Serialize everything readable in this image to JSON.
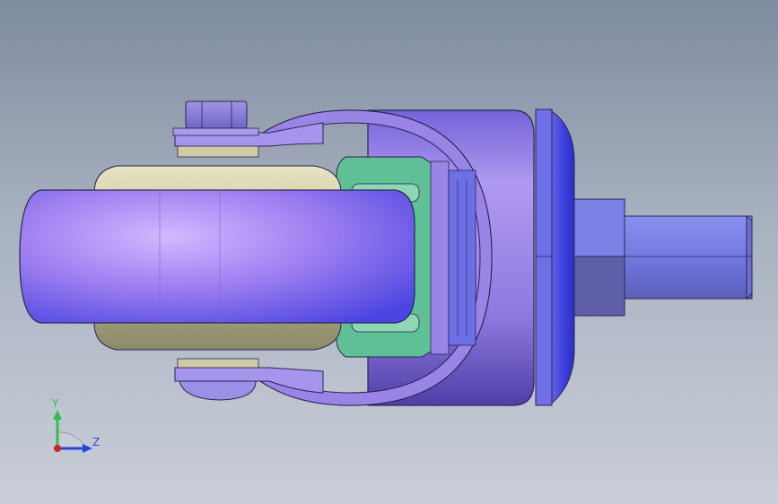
{
  "viewport": {
    "background_top": "#7f8b9f",
    "background_bottom": "#c9ced8"
  },
  "model": {
    "wheel_color": "#9b7df0",
    "hub_color": "#cfcba3",
    "bracket_color": "#9a84e6",
    "bearing_color": "#5fbf95",
    "stem_color": "#7f86e6",
    "outline_color": "#2a2550"
  },
  "triad": {
    "y_label": "Y",
    "z_label": "Z",
    "y_color": "#2fbf4a",
    "z_color": "#2a46d8",
    "x_color": "#d02020"
  }
}
